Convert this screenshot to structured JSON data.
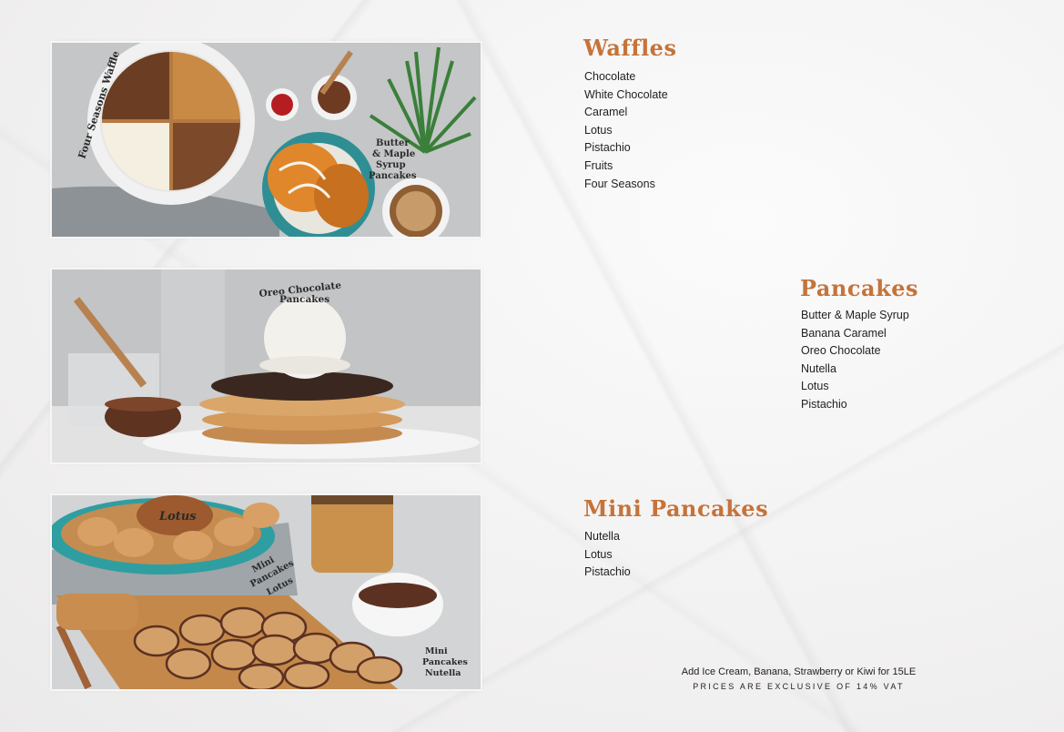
{
  "photos": {
    "waffles": {
      "labels": {
        "four_seasons": "Four Seasons Waffle",
        "butter_maple": [
          "Butter",
          "& Maple",
          "Syrup",
          "Pancakes"
        ]
      }
    },
    "oreo": {
      "labels": {
        "oreo": [
          "Oreo Chocolate",
          "Pancakes"
        ]
      }
    },
    "mini": {
      "labels": {
        "lotus": [
          "Mini",
          "Pancakes",
          "Lotus"
        ],
        "nutella": [
          "Mini",
          "Pancakes",
          "Nutella"
        ],
        "lotus_cookie": "Lotus"
      }
    }
  },
  "sections": {
    "waffles": {
      "title": "Waffles",
      "items": [
        "Chocolate",
        "White Chocolate",
        "Caramel",
        "Lotus",
        "Pistachio",
        "Fruits",
        "Four Seasons"
      ]
    },
    "pancakes": {
      "title": "Pancakes",
      "items": [
        "Butter & Maple Syrup",
        "Banana Caramel",
        "Oreo Chocolate",
        "Nutella",
        "Lotus",
        "Pistachio"
      ]
    },
    "mini_pancakes": {
      "title": "Mini Pancakes",
      "items": [
        "Nutella",
        "Lotus",
        "Pistachio"
      ]
    }
  },
  "footer": {
    "addons": "Add Ice Cream, Banana, Strawberry or Kiwi for 15LE",
    "vat": "PRICES ARE EXCLUSIVE OF 14% VAT"
  },
  "colors": {
    "title_accent": "#c5733a",
    "text": "#1f1f1f"
  }
}
